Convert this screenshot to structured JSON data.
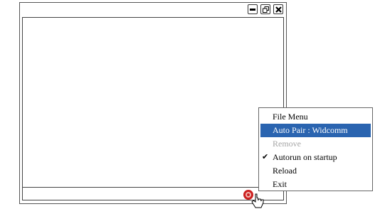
{
  "window": {
    "controls": {
      "minimize_icon": "minimize-icon",
      "restore_icon": "restore-icon",
      "close_icon": "close-icon"
    }
  },
  "context_menu": {
    "items": [
      {
        "label": "File Menu",
        "state": "normal"
      },
      {
        "label": "Auto Pair : Widcomm",
        "state": "highlighted"
      },
      {
        "label": "Remove",
        "state": "disabled"
      },
      {
        "label": "Autorun on startup",
        "state": "checked"
      },
      {
        "label": "Reload",
        "state": "normal"
      },
      {
        "label": "Exit",
        "state": "normal"
      }
    ],
    "highlight_color": "#2a64b0",
    "disabled_color": "#a6a6a6"
  },
  "tray_icon": {
    "icon": "tray-app-icon",
    "color": "#cc2020"
  },
  "cursor": {
    "icon": "pointer-cursor-icon"
  }
}
